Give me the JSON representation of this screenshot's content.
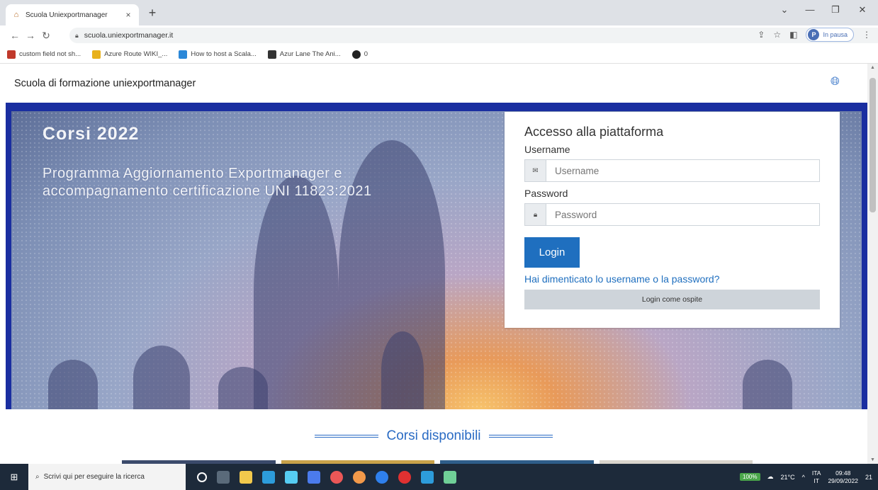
{
  "browser": {
    "tab_title": "Scuola Uniexportmanager",
    "tab_close": "×",
    "new_tab": "+",
    "window_controls": [
      "⌄",
      "—",
      "❐",
      "✕"
    ],
    "url": "scuola.uniexportmanager.it",
    "profile_initial": "P",
    "profile_label": "In pausa",
    "bookmarks": [
      {
        "label": "custom field not sh...",
        "icon": "w-icon",
        "color": "#c0392b"
      },
      {
        "label": "Azure Route WIKI_...",
        "icon": "azure-icon",
        "color": "#e8b11b"
      },
      {
        "label": "How to host a Scala...",
        "icon": "ms-icon",
        "color": "#2b88d8"
      },
      {
        "label": "Azur Lane The Ani...",
        "icon": "azur-lane-icon",
        "color": "#333333"
      },
      {
        "label": "0",
        "icon": "github-icon",
        "color": "#222222"
      }
    ]
  },
  "page": {
    "site_name": "Scuola di formazione uniexportmanager",
    "hero_title": "Corsi 2022",
    "hero_subtitle": "Programma Aggiornamento Exportmanager e accompagnamento certificazione UNI 11823:2021",
    "login": {
      "heading": "Accesso alla piattaforma",
      "username_label": "Username",
      "username_placeholder": "Username",
      "password_label": "Password",
      "password_placeholder": "Password",
      "login_button": "Login",
      "forgot_link": "Hai dimenticato lo username o la password?",
      "guest_button": "Login come ospite"
    },
    "section_title": "Corsi disponibili"
  },
  "taskbar": {
    "search_placeholder": "Scrivi qui per eseguire la ricerca",
    "battery": "100%",
    "temperature": "21°C",
    "language": "ITA",
    "language_sub": "IT",
    "time": "09:48",
    "date": "29/09/2022",
    "notifications": "21"
  },
  "colors": {
    "accent": "#1f6fbf",
    "hero_frame": "#1a2ea0"
  }
}
